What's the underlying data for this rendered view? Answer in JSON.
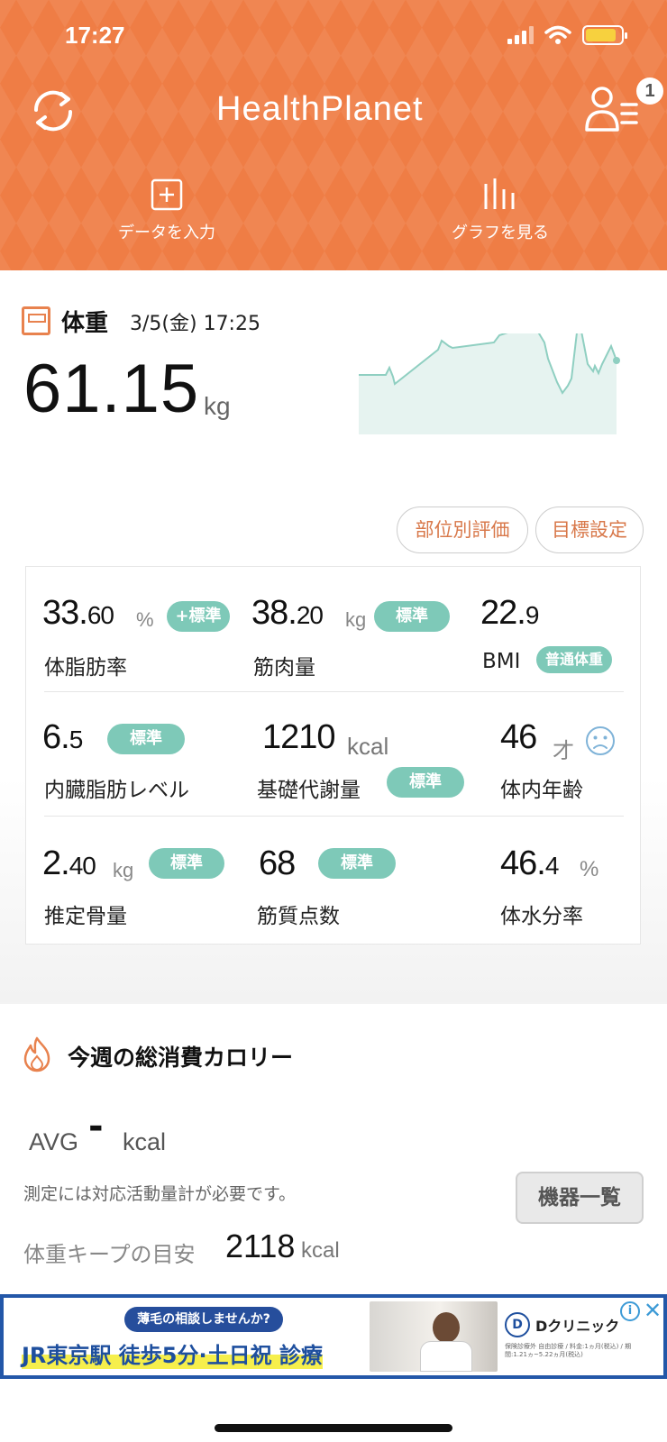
{
  "status_bar": {
    "time": "17:27"
  },
  "header": {
    "app_name": "HealthPlanet",
    "notification_count": "1",
    "actions": [
      {
        "icon": "plus-square-icon",
        "label": "データを入力"
      },
      {
        "icon": "bar-chart-icon",
        "label": "グラフを見る"
      }
    ],
    "color": "#ef7d45"
  },
  "weight": {
    "title": "体重",
    "date": "3/5(金) 17:25",
    "value": "61.15",
    "unit": "kg",
    "buttons": {
      "parts": "部位別評価",
      "goal": "目標設定"
    }
  },
  "metrics": {
    "body_fat": {
      "int": "33.",
      "dec": "60",
      "unit": "%",
      "badge": "+標準",
      "label": "体脂肪率"
    },
    "muscle": {
      "int": "38.",
      "dec": "20",
      "unit": "kg",
      "badge": "標準",
      "label": "筋肉量"
    },
    "bmi": {
      "int": "22.",
      "dec": "9",
      "badge": "普通体重",
      "label": "BMI"
    },
    "visceral": {
      "int": "6.",
      "dec": "5",
      "badge": "標準",
      "label": "内臓脂肪レベル"
    },
    "bmr": {
      "int": "1210",
      "unit": "kcal",
      "badge": "標準",
      "label": "基礎代謝量"
    },
    "body_age": {
      "int": "46",
      "unit": "才",
      "label": "体内年齢"
    },
    "bone": {
      "int": "2.",
      "dec": "40",
      "unit": "kg",
      "badge": "標準",
      "label": "推定骨量"
    },
    "muscle_score": {
      "int": "68",
      "badge": "標準",
      "label": "筋質点数"
    },
    "water": {
      "int": "46.",
      "dec": "4",
      "unit": "%",
      "label": "体水分率"
    },
    "badge_color": "#7ec9b8"
  },
  "calories": {
    "title": "今週の総消費カロリー",
    "avg_label": "AVG",
    "avg_value": "-",
    "avg_unit": "kcal",
    "note": "測定には対応活動量計が必要です。",
    "device_button": "機器一覧",
    "keep_label": "体重キープの目安",
    "keep_value": "2118",
    "keep_unit": "kcal"
  },
  "ad": {
    "catch": "薄毛の相談しませんか?",
    "headline": "JR東京駅 徒歩5分·土日祝 診療",
    "brand": "Dクリニック",
    "mark": "D",
    "fine_print": "保険診療外 自由診療 / 料金:1ヵ月(税込) / 期間:1.21ヵ~5.22ヵ月(税込)"
  }
}
